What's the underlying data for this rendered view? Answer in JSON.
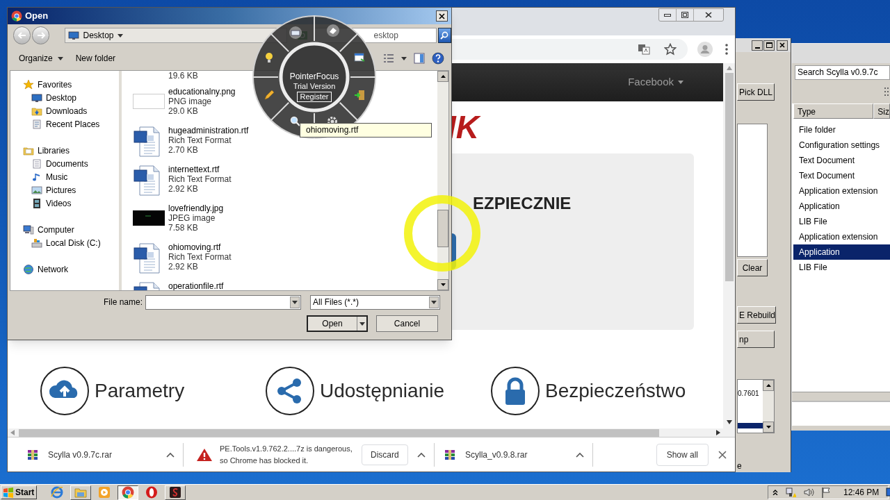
{
  "open_dialog": {
    "title": "Open",
    "location": "Desktop",
    "search_placeholder": "esktop",
    "toolbar": [
      {
        "label": "Organize",
        "dropdown": true
      },
      {
        "label": "New folder",
        "dropdown": false
      }
    ],
    "nav": [
      {
        "label": "Favorites",
        "kind": "star",
        "children": [
          {
            "label": "Desktop",
            "kind": "desktop"
          },
          {
            "label": "Downloads",
            "kind": "downloads"
          },
          {
            "label": "Recent Places",
            "kind": "recent"
          }
        ]
      },
      {
        "label": "Libraries",
        "kind": "library",
        "children": [
          {
            "label": "Documents",
            "kind": "documents"
          },
          {
            "label": "Music",
            "kind": "music"
          },
          {
            "label": "Pictures",
            "kind": "pictures"
          },
          {
            "label": "Videos",
            "kind": "videos"
          }
        ]
      },
      {
        "label": "Computer",
        "kind": "computer",
        "children": [
          {
            "label": "Local Disk (C:)",
            "kind": "disk"
          }
        ]
      },
      {
        "label": "Network",
        "kind": "network"
      }
    ],
    "files": [
      {
        "size": "19.6 KB"
      },
      {
        "kind": "image_light",
        "name": "educationalny.png",
        "type": "PNG image",
        "size": "29.0 KB"
      },
      {
        "kind": "word",
        "name": "hugeadministration.rtf",
        "type": "Rich Text Format",
        "size": "2.70 KB"
      },
      {
        "kind": "word",
        "name": "internettext.rtf",
        "type": "Rich Text Format",
        "size": "2.92 KB"
      },
      {
        "kind": "image_dark",
        "name": "lovefriendly.jpg",
        "type": "JPEG image",
        "size": "7.58 KB"
      },
      {
        "kind": "word",
        "name": "ohiomoving.rtf",
        "type": "Rich Text Format",
        "size": "2.92 KB"
      },
      {
        "kind": "word",
        "name": "operationfile.rtf"
      }
    ],
    "file_name_label": "File name:",
    "filter": "All Files (*.*)",
    "buttons": [
      {
        "label": "Open",
        "kind": "split"
      },
      {
        "label": "Cancel",
        "kind": "plain"
      }
    ],
    "tooltip": "ohiomoving.rtf"
  },
  "pointer_focus": {
    "title": "PointerFocus",
    "subtitle": "Trial Version",
    "button": "Register"
  },
  "browser": {
    "nav_link": "Facebook",
    "heading": "IK",
    "banner": "EZPIECZNIE",
    "features": [
      {
        "label": "Parametry",
        "kind": "cloud_upload"
      },
      {
        "label": "Udostępnianie",
        "kind": "share"
      },
      {
        "label": "Bezpieczeństwo",
        "kind": "lock"
      }
    ],
    "downloads": [
      {
        "kind": "file",
        "name": "Scylla v0.9.7c.rar"
      },
      {
        "kind": "blocked",
        "message": "PE.Tools.v1.9.762.2....7z is dangerous, so Chrome has blocked it.",
        "action": "Discard"
      },
      {
        "kind": "file",
        "name": "Scylla_v0.9.8.rar"
      }
    ],
    "show_all": "Show all"
  },
  "scylla": {
    "buttons": [
      "Pick DLL",
      "Clear",
      "E Rebuild",
      "np"
    ],
    "log_value": "0.7601",
    "status": "e"
  },
  "explorer": {
    "search_placeholder": "Search Scylla v0.9.7c",
    "columns": [
      "Type",
      "Siz"
    ],
    "rows": [
      {
        "type": "File folder",
        "selected": false
      },
      {
        "type": "Configuration settings",
        "selected": false
      },
      {
        "type": "Text Document",
        "selected": false
      },
      {
        "type": "Text Document",
        "selected": false
      },
      {
        "type": "Application extension",
        "selected": false
      },
      {
        "type": "Application",
        "selected": false
      },
      {
        "type": "LIB File",
        "selected": false
      },
      {
        "type": "Application extension",
        "selected": false
      },
      {
        "type": "Application",
        "selected": true
      },
      {
        "type": "LIB File",
        "selected": false
      }
    ]
  },
  "taskbar": {
    "start": "Start",
    "apps": [
      {
        "kind": "ie",
        "open": false,
        "active": false
      },
      {
        "kind": "folder",
        "open": true,
        "active": false
      },
      {
        "kind": "media",
        "open": false,
        "active": false
      },
      {
        "kind": "chrome",
        "open": true,
        "active": true
      },
      {
        "kind": "opera",
        "open": false,
        "active": false
      },
      {
        "kind": "dark_app",
        "open": true,
        "active": false
      }
    ],
    "clock": "12:46 PM"
  }
}
